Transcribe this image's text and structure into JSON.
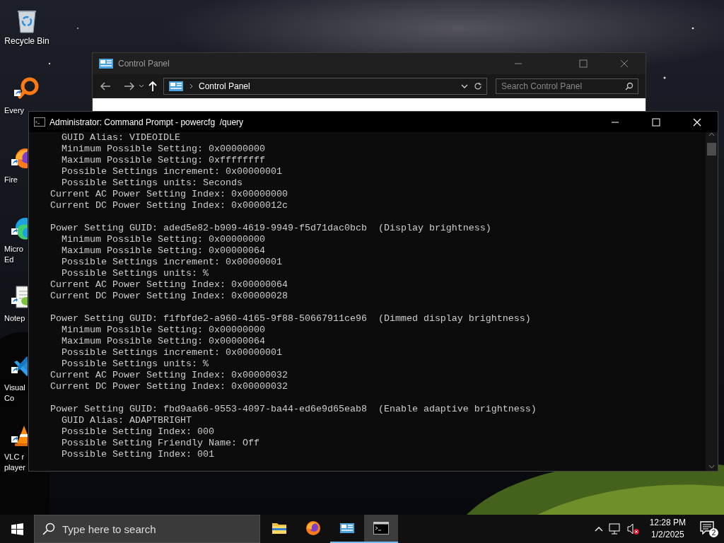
{
  "desktop_icons": [
    {
      "kind": "recycle",
      "lines": [
        "Recycle Bin"
      ]
    },
    {
      "kind": "magnifier",
      "lines": [
        "Every"
      ]
    },
    {
      "kind": "firefox",
      "lines": [
        "Fire"
      ]
    },
    {
      "kind": "edge",
      "lines": [
        "Micro",
        "Ed"
      ]
    },
    {
      "kind": "notepad",
      "lines": [
        "Notep"
      ]
    },
    {
      "kind": "vscode",
      "lines": [
        "Visual",
        "Co"
      ]
    },
    {
      "kind": "vlc",
      "lines": [
        "VLC r",
        "player"
      ]
    }
  ],
  "control_panel": {
    "title": "Control Panel",
    "address": "Control Panel",
    "search": {
      "placeholder": "Search Control Panel"
    }
  },
  "console": {
    "title": "Administrator: Command Prompt - powercfg  /query",
    "blocks": [
      [
        "  GUID Alias: VIDEOIDLE",
        "  Minimum Possible Setting: 0x00000000",
        "  Maximum Possible Setting: 0xffffffff",
        "  Possible Settings increment: 0x00000001",
        "  Possible Settings units: Seconds",
        "Current AC Power Setting Index: 0x00000000",
        "Current DC Power Setting Index: 0x0000012c"
      ],
      [
        "Power Setting GUID: aded5e82-b909-4619-9949-f5d71dac0bcb  (Display brightness)",
        "  Minimum Possible Setting: 0x00000000",
        "  Maximum Possible Setting: 0x00000064",
        "  Possible Settings increment: 0x00000001",
        "  Possible Settings units: %",
        "Current AC Power Setting Index: 0x00000064",
        "Current DC Power Setting Index: 0x00000028"
      ],
      [
        "Power Setting GUID: f1fbfde2-a960-4165-9f88-50667911ce96  (Dimmed display brightness)",
        "  Minimum Possible Setting: 0x00000000",
        "  Maximum Possible Setting: 0x00000064",
        "  Possible Settings increment: 0x00000001",
        "  Possible Settings units: %",
        "Current AC Power Setting Index: 0x00000032",
        "Current DC Power Setting Index: 0x00000032"
      ],
      [
        "Power Setting GUID: fbd9aa66-9553-4097-ba44-ed6e9d65eab8  (Enable adaptive brightness)",
        "  GUID Alias: ADAPTBRIGHT",
        "  Possible Setting Index: 000",
        "  Possible Setting Friendly Name: Off",
        "  Possible Setting Index: 001"
      ]
    ]
  },
  "taskbar": {
    "search": {
      "placeholder": "Type here to search"
    },
    "apps": [
      {
        "kind": "explorer",
        "running": false,
        "selected": false
      },
      {
        "kind": "firefox",
        "running": false,
        "selected": false
      },
      {
        "kind": "controlpanel",
        "running": true,
        "selected": false
      },
      {
        "kind": "cmd",
        "running": true,
        "selected": true
      }
    ],
    "time": "12:28 PM",
    "date": "1/2/2025",
    "notification_count": "2"
  }
}
